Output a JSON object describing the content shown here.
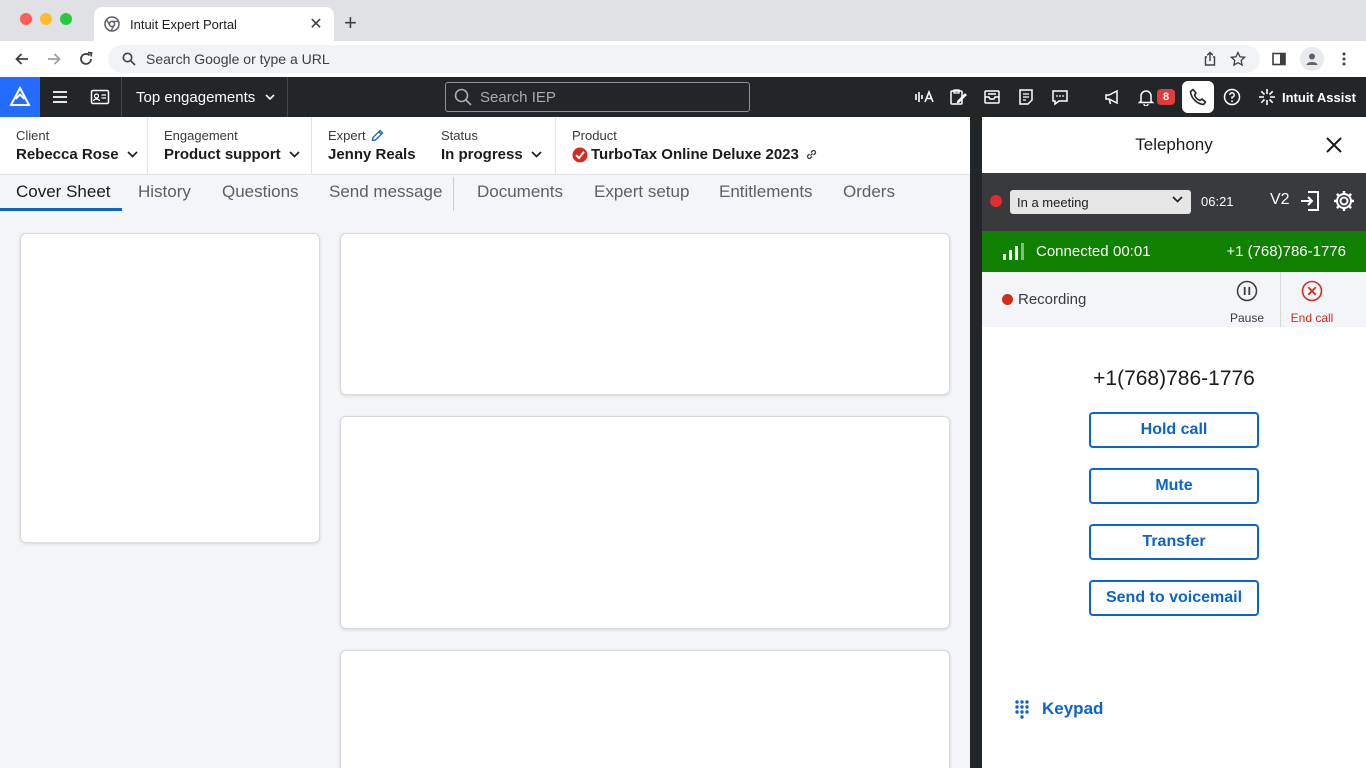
{
  "browser": {
    "tab_title": "Intuit Expert Portal",
    "omnibox_placeholder": "Search Google or type a URL"
  },
  "appbar": {
    "top_engagements": "Top engagements",
    "search_placeholder": "Search IEP",
    "notification_count": "8",
    "assist_label": "Intuit Assist"
  },
  "info": {
    "client_label": "Client",
    "client_value": "Rebecca Rose",
    "engagement_label": "Engagement",
    "engagement_value": "Product support",
    "expert_label": "Expert",
    "expert_value": "Jenny Reals",
    "status_label": "Status",
    "status_value": "In progress",
    "product_label": "Product",
    "product_value": "TurboTax Online Deluxe 2023"
  },
  "tabs": [
    {
      "label": "Cover Sheet",
      "active": true
    },
    {
      "label": "History"
    },
    {
      "label": "Questions"
    },
    {
      "label": "Send message"
    },
    {
      "label": "Documents"
    },
    {
      "label": "Expert setup"
    },
    {
      "label": "Entitlements"
    },
    {
      "label": "Orders"
    }
  ],
  "telephony": {
    "title": "Telephony",
    "status_value": "In a meeting",
    "status_timer": "06:21",
    "version": "V2",
    "connected_label": "Connected",
    "connected_time": "00:01",
    "connected_number": "+1 (768)786-1776",
    "recording_label": "Recording",
    "pause_label": "Pause",
    "end_call_label": "End call",
    "dial_number": "+1(768)786-1776",
    "buttons": {
      "hold": "Hold call",
      "mute": "Mute",
      "transfer": "Transfer",
      "voicemail": "Send to voicemail"
    },
    "keypad_label": "Keypad"
  },
  "colors": {
    "accent": "#0b64c9",
    "appbar": "#232629",
    "connected": "#108000",
    "end_call": "#d52b1e",
    "logo": "#236cff"
  }
}
